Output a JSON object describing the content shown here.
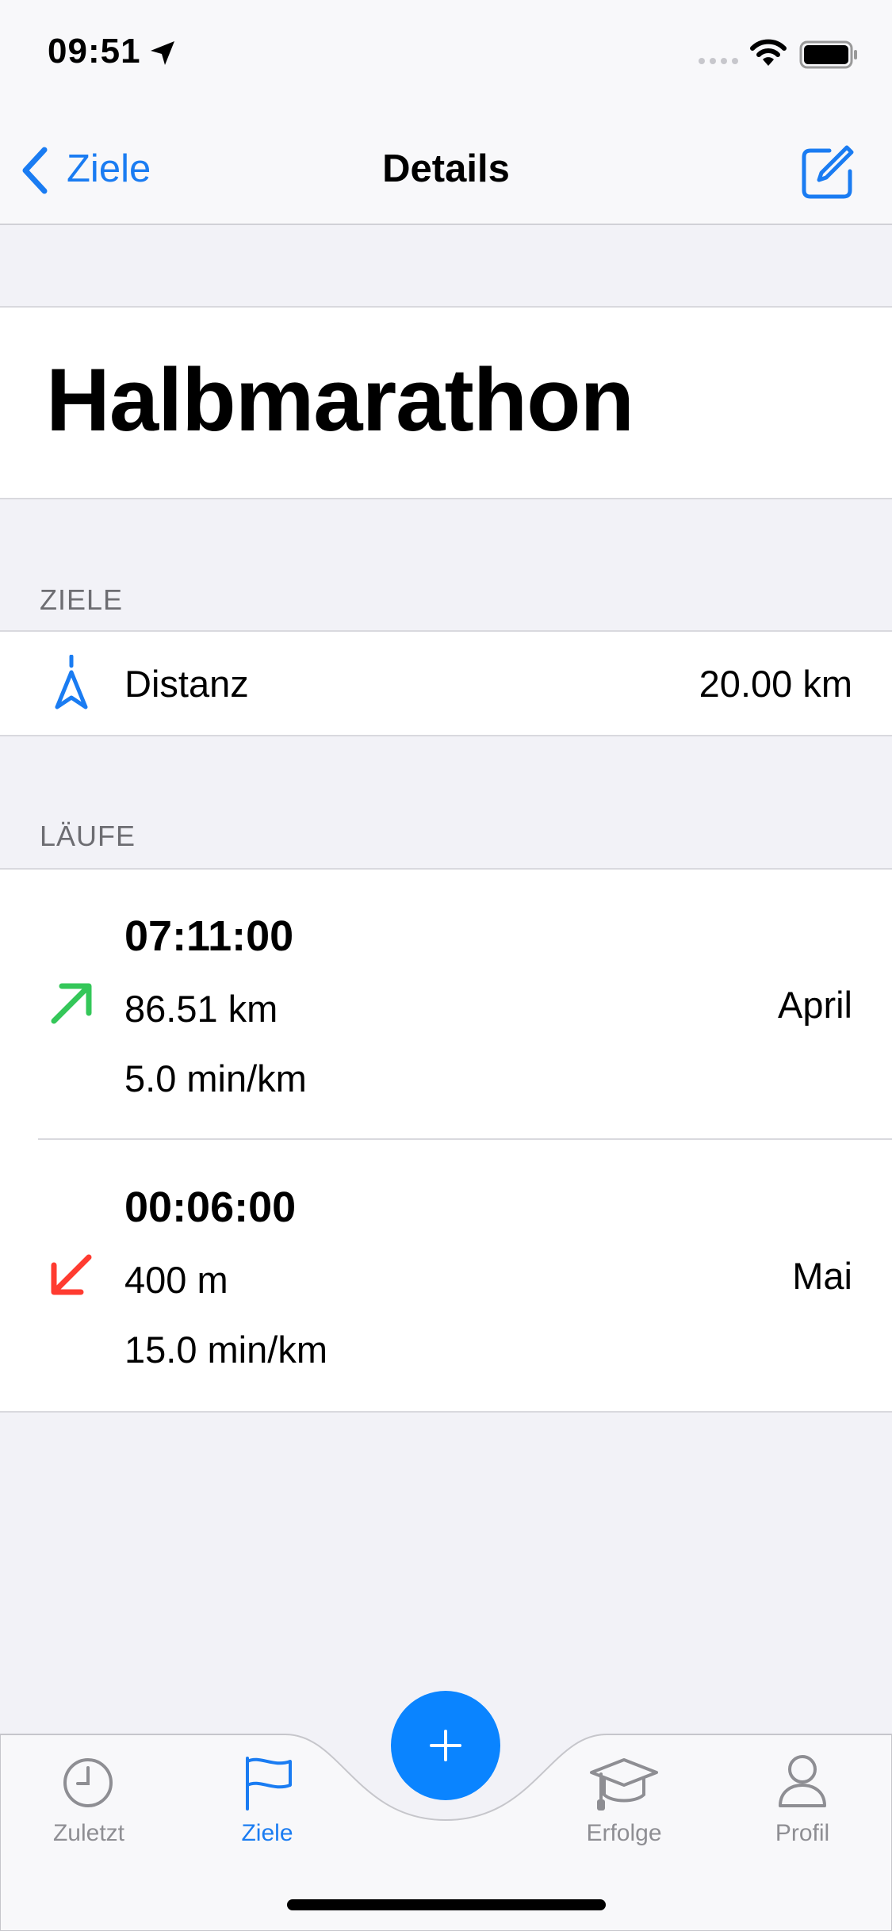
{
  "status_bar": {
    "time": "09:51"
  },
  "nav": {
    "back_label": "Ziele",
    "title": "Details"
  },
  "goal": {
    "title": "Halbmarathon"
  },
  "ziele_section": {
    "header": "ZIELE",
    "items": [
      {
        "label": "Distanz",
        "value": "20.00 km"
      }
    ]
  },
  "runs_section": {
    "header": "LÄUFE",
    "runs": [
      {
        "duration": "07:11:00",
        "distance": "86.51 km",
        "pace": "5.0 min/km",
        "month": "April",
        "trend": "up",
        "trend_color": "#34c759"
      },
      {
        "duration": "00:06:00",
        "distance": "400 m",
        "pace": "15.0 min/km",
        "month": "Mai",
        "trend": "down",
        "trend_color": "#ff3b30"
      }
    ]
  },
  "tab_bar": {
    "tabs": [
      {
        "label": "Zuletzt",
        "icon": "clock-icon",
        "active": false
      },
      {
        "label": "Ziele",
        "icon": "flag-icon",
        "active": true
      },
      {
        "label": "Erfolge",
        "icon": "graduation-cap-icon",
        "active": false
      },
      {
        "label": "Profil",
        "icon": "person-icon",
        "active": false
      }
    ],
    "center_button": "plus-icon"
  },
  "colors": {
    "accent": "#1a7cf2",
    "fab": "#0a84ff",
    "up": "#34c759",
    "down": "#ff3b30"
  }
}
